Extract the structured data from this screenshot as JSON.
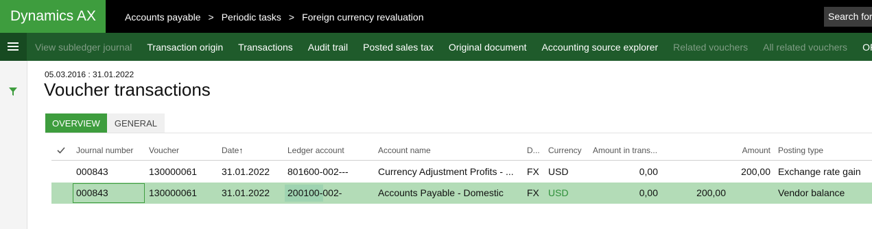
{
  "app": {
    "brand": "Dynamics AX"
  },
  "breadcrumb": [
    "Accounts payable",
    "Periodic tasks",
    "Foreign currency revaluation"
  ],
  "breadcrumb_separator": ">",
  "search": {
    "label": "Search for"
  },
  "actions": [
    {
      "label": "View subledger journal",
      "enabled": false
    },
    {
      "label": "Transaction origin",
      "enabled": true
    },
    {
      "label": "Transactions",
      "enabled": true
    },
    {
      "label": "Audit trail",
      "enabled": true
    },
    {
      "label": "Posted sales tax",
      "enabled": true
    },
    {
      "label": "Original document",
      "enabled": true
    },
    {
      "label": "Accounting source explorer",
      "enabled": true
    },
    {
      "label": "Related vouchers",
      "enabled": false
    },
    {
      "label": "All related vouchers",
      "enabled": false
    },
    {
      "label": "OPT",
      "enabled": true
    }
  ],
  "page": {
    "date_range": "05.03.2016 : 31.01.2022",
    "title": "Voucher transactions"
  },
  "tabs": [
    {
      "label": "OVERVIEW",
      "active": true
    },
    {
      "label": "GENERAL",
      "active": false
    }
  ],
  "grid": {
    "headers": {
      "journal": "Journal number",
      "voucher": "Voucher",
      "date": "Date",
      "date_sort": "↑",
      "ledger": "Ledger account",
      "account_name": "Account name",
      "d": "D...",
      "currency": "Currency",
      "amount_trans": "Amount in trans...",
      "amount": "Amount",
      "posting_type": "Posting type"
    },
    "rows": [
      {
        "journal": "000843",
        "voucher": "130000061",
        "date": "31.01.2022",
        "ledger": "801600-002---",
        "account_name": "Currency Adjustment Profits - ...",
        "d": "FX",
        "currency": "USD",
        "amount_trans": "0,00",
        "extra": "",
        "amount": "200,00",
        "posting_type": "Exchange rate gain"
      },
      {
        "journal": "000843",
        "voucher": "130000061",
        "date": "31.01.2022",
        "ledger": "200100-002-",
        "account_name": "Accounts Payable - Domestic",
        "d": "FX",
        "currency": "USD",
        "amount_trans": "0,00",
        "extra": "200,00",
        "amount": "",
        "posting_type": "Vendor balance"
      }
    ]
  },
  "colors": {
    "brand_green": "#3e9d3e",
    "action_bar": "#1f5b2b",
    "selected_row": "#b3dcb7"
  },
  "icons": [
    "hamburger-icon",
    "filter-icon",
    "checkmark-icon",
    "sort-up-icon"
  ]
}
